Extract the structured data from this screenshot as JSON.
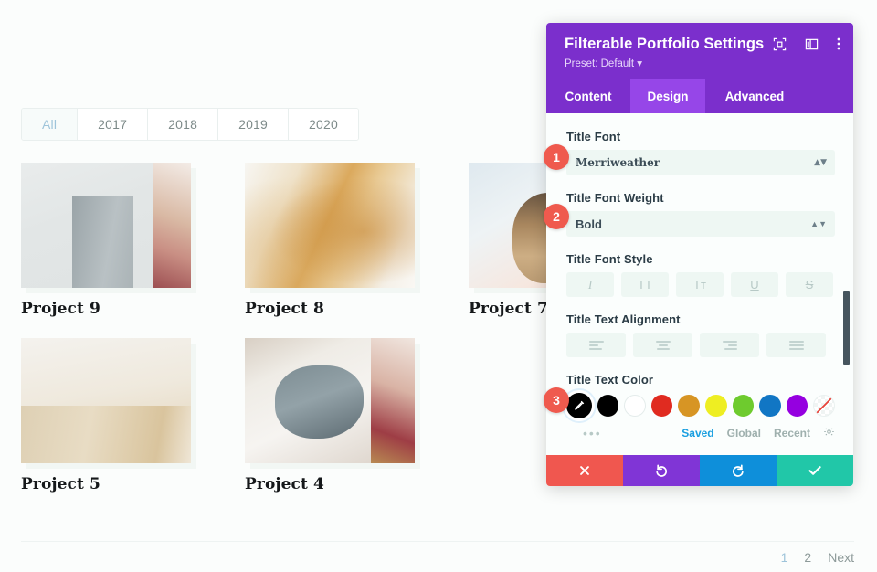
{
  "portfolio": {
    "filters": [
      {
        "label": "All",
        "active": true
      },
      {
        "label": "2017",
        "active": false
      },
      {
        "label": "2018",
        "active": false
      },
      {
        "label": "2019",
        "active": false
      },
      {
        "label": "2020",
        "active": false
      }
    ],
    "projects": [
      {
        "title": "Project 9"
      },
      {
        "title": "Project 8"
      },
      {
        "title": "Project 7"
      },
      {
        "title": "Project 5"
      },
      {
        "title": "Project 4"
      }
    ],
    "pagination": [
      {
        "label": "1",
        "active": true
      },
      {
        "label": "2",
        "active": false
      },
      {
        "label": "Next",
        "active": false
      }
    ]
  },
  "modal": {
    "title": "Filterable Portfolio Settings",
    "preset": "Preset: Default",
    "header_icons": [
      "focus-icon",
      "layout-icon",
      "more-vertical-icon"
    ],
    "tabs": [
      {
        "label": "Content",
        "active": false
      },
      {
        "label": "Design",
        "active": true
      },
      {
        "label": "Advanced",
        "active": false
      }
    ],
    "fields": {
      "title_font": {
        "label": "Title Font",
        "value": "Merriweather"
      },
      "title_font_weight": {
        "label": "Title Font Weight",
        "value": "Bold"
      },
      "title_font_style": {
        "label": "Title Font Style",
        "options": [
          {
            "name": "italic-icon",
            "glyph": "I"
          },
          {
            "name": "uppercase-icon",
            "glyph": "TT"
          },
          {
            "name": "smallcaps-icon",
            "glyph": "Tᴛ"
          },
          {
            "name": "underline-icon",
            "glyph": "U"
          },
          {
            "name": "strikethrough-icon",
            "glyph": "S"
          }
        ]
      },
      "title_text_alignment": {
        "label": "Title Text Alignment",
        "options": [
          "align-left-icon",
          "align-center-icon",
          "align-right-icon",
          "align-justify-icon"
        ]
      },
      "title_text_color": {
        "label": "Title Text Color",
        "swatches": [
          {
            "name": "color-picker-swatch",
            "color": "#000000"
          },
          {
            "name": "swatch-black",
            "color": "#000000"
          },
          {
            "name": "swatch-white",
            "color": "#ffffff"
          },
          {
            "name": "swatch-red",
            "color": "#e02b20"
          },
          {
            "name": "swatch-orange",
            "color": "#d79524"
          },
          {
            "name": "swatch-yellow",
            "color": "#eeee22"
          },
          {
            "name": "swatch-green",
            "color": "#6ecb2e"
          },
          {
            "name": "swatch-blue",
            "color": "#1176c4"
          },
          {
            "name": "swatch-purple",
            "color": "#9500e0"
          },
          {
            "name": "swatch-transparent",
            "color": "transparent"
          }
        ],
        "tabs": [
          {
            "label": "Saved",
            "active": true
          },
          {
            "label": "Global",
            "active": false
          },
          {
            "label": "Recent",
            "active": false
          }
        ],
        "settings_icon": "gear-icon",
        "more_icon": "ellipsis-icon"
      }
    },
    "actions": [
      {
        "name": "cancel-button",
        "icon": "close-icon",
        "color": "#f0574f"
      },
      {
        "name": "undo-button",
        "icon": "undo-icon",
        "color": "#8035d6"
      },
      {
        "name": "redo-button",
        "icon": "redo-icon",
        "color": "#0e8fda"
      },
      {
        "name": "save-button",
        "icon": "check-icon",
        "color": "#21c7a8"
      }
    ]
  },
  "callouts": [
    {
      "number": "1"
    },
    {
      "number": "2"
    },
    {
      "number": "3"
    }
  ]
}
